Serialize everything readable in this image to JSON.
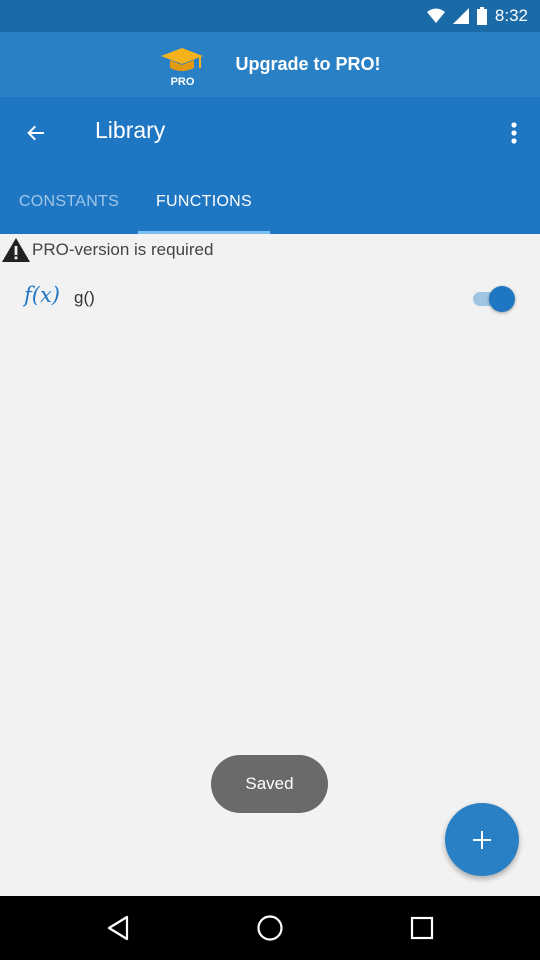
{
  "status_bar": {
    "time": "8:32"
  },
  "banner": {
    "badge_text": "PRO",
    "text": "Upgrade to PRO!"
  },
  "toolbar": {
    "title": "Library"
  },
  "tabs": [
    {
      "label": "CONSTANTS"
    },
    {
      "label": "FUNCTIONS"
    }
  ],
  "warning": {
    "text": "PRO-version is required"
  },
  "functions": [
    {
      "icon_text": "f(x)",
      "name": "g()",
      "enabled": true
    }
  ],
  "toast": {
    "text": "Saved"
  },
  "colors": {
    "primary": "#1f76c2",
    "banner": "#2980c4",
    "status_bar": "#1b6aa8",
    "background": "#f2f2f2",
    "toast": "#6a6a6a",
    "accent_logo": "#f5b21b"
  }
}
